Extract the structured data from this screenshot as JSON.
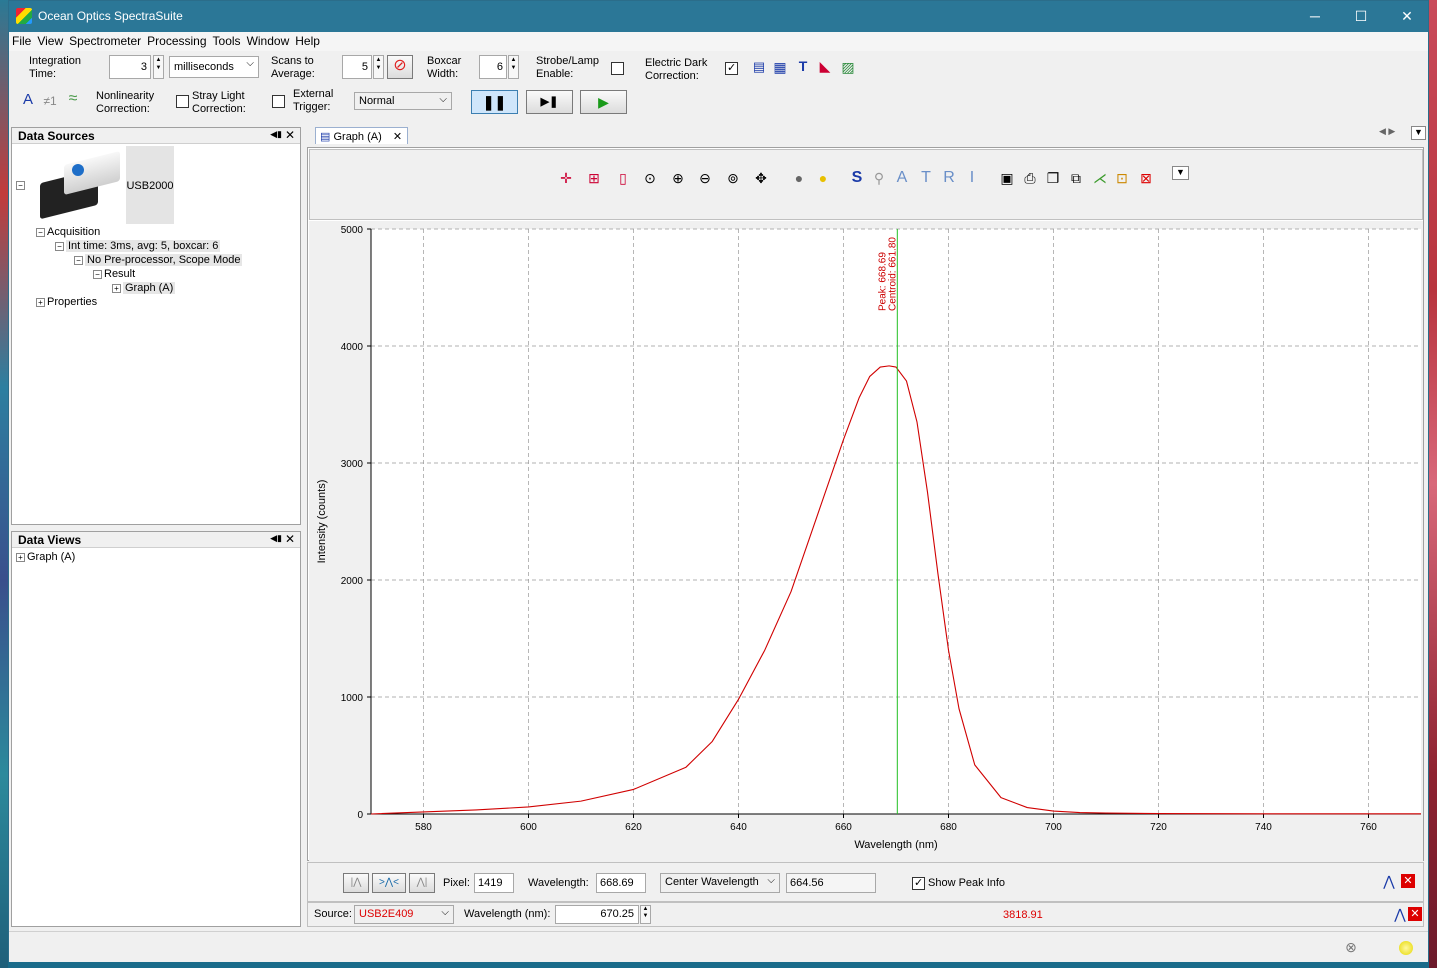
{
  "app": {
    "title": "Ocean Optics SpectraSuite",
    "controls": {
      "minimize": "─",
      "maximize": "☐",
      "close": "✕"
    }
  },
  "menu": [
    "File",
    "View",
    "Spectrometer",
    "Processing",
    "Tools",
    "Window",
    "Help"
  ],
  "toolbar": {
    "integration_label1": "Integration",
    "integration_label2": "Time:",
    "integration_value": "3",
    "integration_unit": "milliseconds",
    "scans_label1": "Scans to",
    "scans_label2": "Average:",
    "scans_value": "5",
    "boxcar_label1": "Boxcar",
    "boxcar_label2": "Width:",
    "boxcar_value": "6",
    "strobe_label1": "Strobe/Lamp",
    "strobe_label2": "Enable:",
    "dark_label1": "Electric Dark",
    "dark_label2": "Correction:",
    "nonlin_label1": "Nonlinearity",
    "nonlin_label2": "Correction:",
    "stray_label1": "Stray Light",
    "stray_label2": "Correction:",
    "trigger_label1": "External",
    "trigger_label2": "Trigger:",
    "trigger_mode": "Normal"
  },
  "data_sources": {
    "title": "Data Sources",
    "device": "USB2000",
    "acquisition": "Acquisition",
    "int_time": "Int time: 3ms, avg: 5, boxcar: 6",
    "preproc": "No Pre-processor, Scope Mode",
    "result": "Result",
    "graph": "Graph (A)",
    "properties": "Properties"
  },
  "data_views": {
    "title": "Data Views",
    "graph": "Graph (A)"
  },
  "graph_tab": "Graph (A)",
  "graph_toolbar_letters": [
    "S",
    "A",
    "T",
    "R",
    "I"
  ],
  "chart_data": {
    "type": "line",
    "xlabel": "Wavelength (nm)",
    "ylabel": "Intensity (counts)",
    "xlim": [
      570,
      770
    ],
    "ylim": [
      0,
      5000
    ],
    "xticks": [
      580,
      600,
      620,
      640,
      660,
      680,
      700,
      720,
      740,
      760
    ],
    "yticks": [
      0,
      1000,
      2000,
      3000,
      4000,
      5000
    ],
    "grid": true,
    "series": [
      {
        "color": "#d00000",
        "x": [
          570,
          580,
          590,
          600,
          610,
          620,
          630,
          635,
          640,
          645,
          650,
          655,
          660,
          663,
          665,
          667,
          668.69,
          670,
          672,
          674,
          676,
          678,
          680,
          682,
          685,
          690,
          695,
          700,
          705,
          710,
          720,
          730,
          740,
          750,
          760,
          770
        ],
        "y": [
          0,
          18,
          35,
          60,
          110,
          210,
          400,
          620,
          980,
          1400,
          1900,
          2550,
          3200,
          3560,
          3740,
          3820,
          3830,
          3820,
          3700,
          3350,
          2750,
          2050,
          1400,
          900,
          420,
          140,
          55,
          25,
          12,
          8,
          4,
          3,
          2,
          2,
          2,
          2
        ]
      }
    ],
    "marker_x": 670.25,
    "peak_label": "Peak: 668.69",
    "centroid_label": "Centroid: 661.80"
  },
  "footer": {
    "pixel_label": "Pixel:",
    "pixel_value": "1419",
    "wavelength_label": "Wavelength:",
    "wavelength_value": "668.69",
    "center_mode": "Center Wavelength",
    "center_value": "664.56",
    "show_peak": "Show Peak Info",
    "source_label": "Source:",
    "source_value": "USB2E409",
    "wl_nm_label": "Wavelength (nm):",
    "wl_nm_value": "670.25",
    "intensity_readout": "3818.91"
  }
}
